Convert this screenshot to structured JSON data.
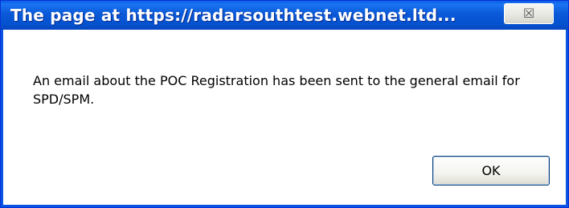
{
  "dialog": {
    "title": "The page at https://radarsouthtest.webnet.ltd...",
    "close_label": "☒",
    "message": "An email about the POC Registration has been sent to the general email for SPD/SPM.",
    "ok_label": "OK"
  },
  "colors": {
    "titlebar": "#0a59d8",
    "title_text": "#ffffff",
    "client_bg": "#ffffff",
    "button_border": "#003c74"
  },
  "icons": {
    "close": "close-icon"
  }
}
